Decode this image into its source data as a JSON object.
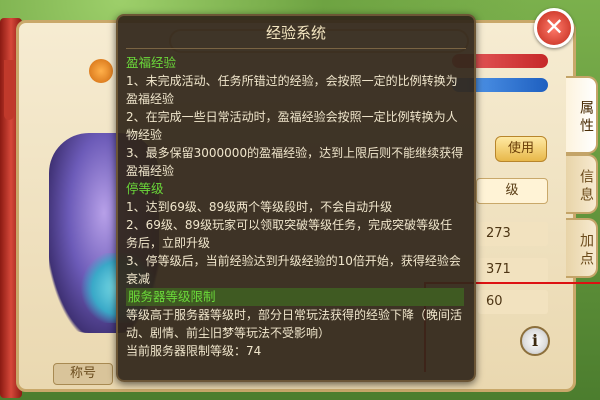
{
  "background_panel": {
    "name_label": "称号",
    "use_button": "使用",
    "level_header": "级",
    "stats": [
      "273",
      "371",
      "60"
    ],
    "info_button": "i"
  },
  "side_tabs": {
    "attributes": "属性",
    "info": "信息",
    "add_points": "加点"
  },
  "close_button": "✕",
  "exp_popup": {
    "title": "经验系统",
    "sections": [
      {
        "heading": "盈福经验",
        "lines": [
          "1、未完成活动、任务所错过的经验，会按照一定的比例转换为盈福经验",
          "2、在完成一些日常活动时，盈福经验会按照一定比例转换为人物经验",
          "3、最多保留3000000的盈福经验，达到上限后则不能继续获得盈福经验"
        ]
      },
      {
        "heading": "停等级",
        "lines": [
          "1、达到69级、89级两个等级段时，不会自动升级",
          "2、69级、89级玩家可以领取突破等级任务，完成突破等级任务后，立即升级",
          "3、停等级后，当前经验达到升级经验的10倍开始，获得经验会衰减"
        ]
      },
      {
        "heading": "服务器等级限制",
        "lines": [
          "等级高于服务器等级时，部分日常玩法获得的经验下降（晚间活动、剧情、前尘旧梦等玩法不受影响）",
          "当前服务器限制等级：74"
        ]
      }
    ]
  }
}
